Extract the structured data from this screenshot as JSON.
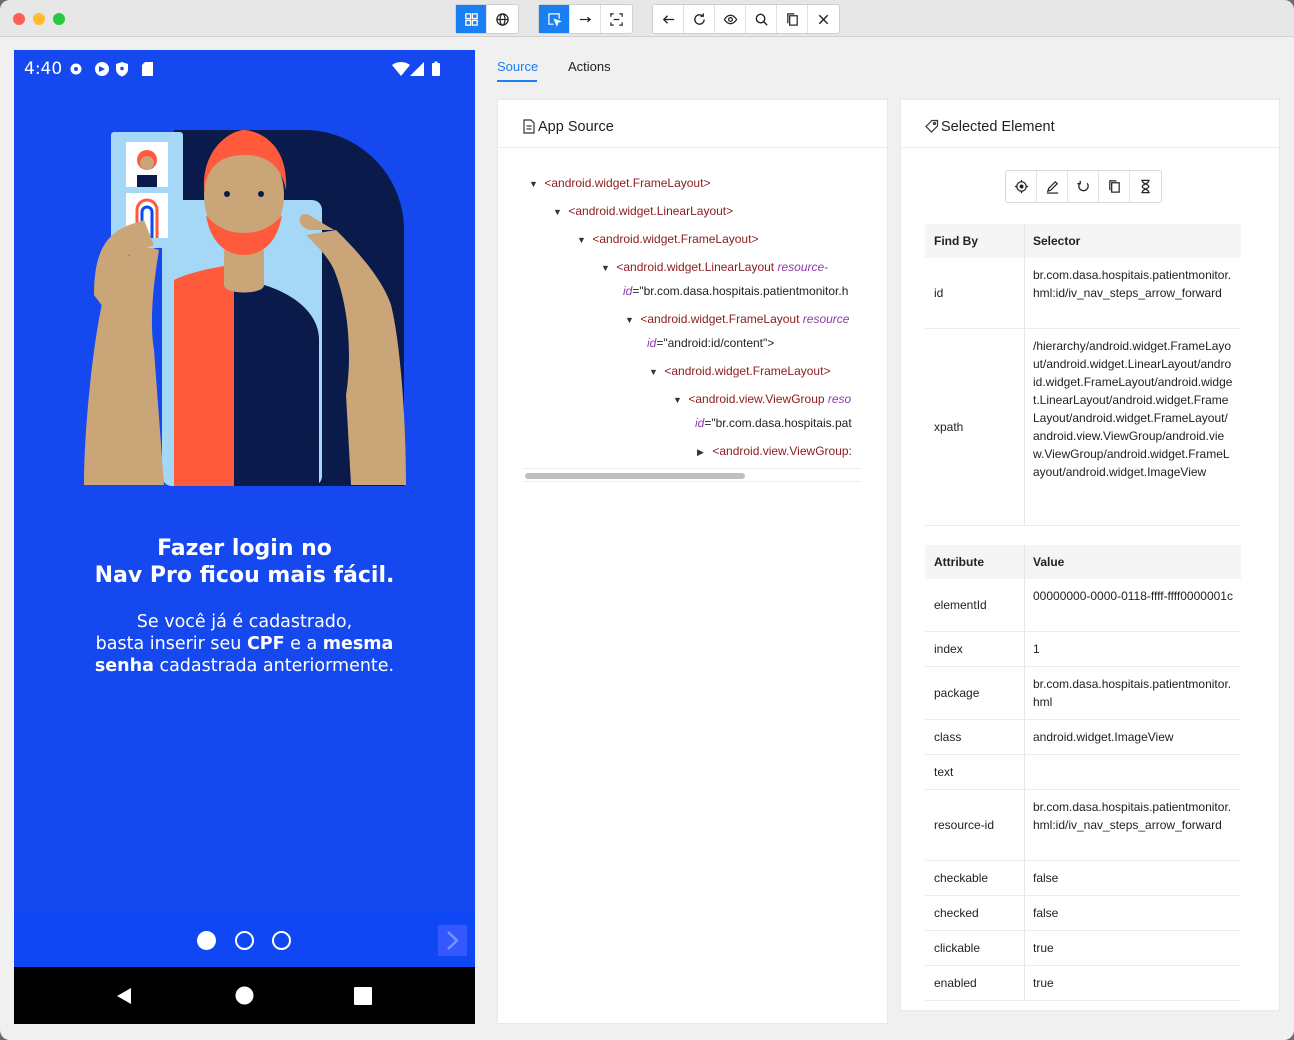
{
  "toolbar": {
    "groups": [
      [
        "grid-icon",
        "globe-icon"
      ],
      [
        "select-element-icon",
        "swipe-icon",
        "tap-area-icon"
      ],
      [
        "back-icon",
        "refresh-icon",
        "eye-icon",
        "search-icon",
        "copy-icon",
        "close-icon"
      ]
    ]
  },
  "device": {
    "time": "4:40",
    "headline_line1": "Fazer login no",
    "headline_line2": "Nav Pro ficou mais fácil.",
    "sub_line1": "Se você já é cadastrado,",
    "sub_line2_a": "basta inserir seu ",
    "sub_line2_b": "CPF",
    "sub_line2_c": " e a ",
    "sub_line2_d": "mesma",
    "sub_line3_a": "senha",
    "sub_line3_b": " cadastrada anteriormente."
  },
  "tabs": {
    "source": "Source",
    "actions": "Actions"
  },
  "source_panel": {
    "title": "App Source",
    "nodes": [
      {
        "tag": "<android.widget.FrameLayout>",
        "attr": "",
        "val": ""
      },
      {
        "tag": "<android.widget.LinearLayout>",
        "attr": "",
        "val": ""
      },
      {
        "tag": "<android.widget.FrameLayout>",
        "attr": "",
        "val": ""
      },
      {
        "tag": "<android.widget.LinearLayout ",
        "attr": "resource-",
        "val": ""
      },
      {
        "tag": "",
        "attr": "id",
        "val": "=\"br.com.dasa.hospitais.patientmonitor.h"
      },
      {
        "tag": "<android.widget.FrameLayout ",
        "attr": "resource",
        "val": ""
      },
      {
        "tag": "",
        "attr": "id",
        "val": "=\"android:id/content\">"
      },
      {
        "tag": "<android.widget.FrameLayout>",
        "attr": "",
        "val": ""
      },
      {
        "tag": "<android.view.ViewGroup ",
        "attr": "reso",
        "val": ""
      },
      {
        "tag": "",
        "attr": "id",
        "val": "=\"br.com.dasa.hospitais.pat"
      },
      {
        "tag": "<android.view.ViewGroup:",
        "attr": "",
        "val": ""
      }
    ]
  },
  "selected_panel": {
    "title": "Selected Element",
    "tools": [
      "tap-icon",
      "edit-icon",
      "clear-icon",
      "copy-icon",
      "timer-icon"
    ],
    "findby_header": {
      "col1": "Find By",
      "col2": "Selector"
    },
    "findby": [
      {
        "key": "id",
        "value": "br.com.dasa.hospitais.patientmonitor.hml:id/iv_nav_steps_arrow_forward"
      },
      {
        "key": "xpath",
        "value": "/hierarchy/android.widget.FrameLayout/android.widget.LinearLayout/android.widget.FrameLayout/android.widget.LinearLayout/android.widget.FrameLayout/android.widget.FrameLayout/android.view.ViewGroup/android.view.ViewGroup/android.widget.FrameLayout/android.widget.ImageView"
      }
    ],
    "attr_header": {
      "col1": "Attribute",
      "col2": "Value"
    },
    "attributes": [
      {
        "key": "elementId",
        "value": "00000000-0000-0118-ffff-ffff0000001c"
      },
      {
        "key": "index",
        "value": "1"
      },
      {
        "key": "package",
        "value": "br.com.dasa.hospitais.patientmonitor.hml"
      },
      {
        "key": "class",
        "value": "android.widget.ImageView"
      },
      {
        "key": "text",
        "value": ""
      },
      {
        "key": "resource-id",
        "value": "br.com.dasa.hospitais.patientmonitor.hml:id/iv_nav_steps_arrow_forward"
      },
      {
        "key": "checkable",
        "value": "false"
      },
      {
        "key": "checked",
        "value": "false"
      },
      {
        "key": "clickable",
        "value": "true"
      },
      {
        "key": "enabled",
        "value": "true"
      }
    ]
  }
}
